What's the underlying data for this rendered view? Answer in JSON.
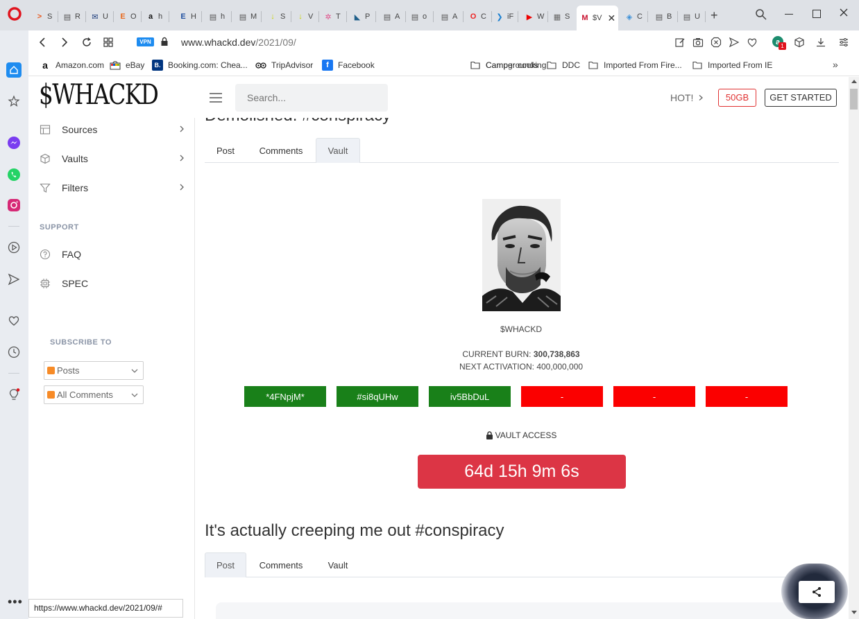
{
  "browser": {
    "tabs": [
      {
        "letter": ">",
        "label": "S",
        "color": "#e8591f"
      },
      {
        "letter": "▤",
        "label": "R",
        "color": "#555"
      },
      {
        "letter": "✉",
        "label": "U",
        "color": "#1a3a7a"
      },
      {
        "letter": "E",
        "label": "O",
        "color": "#e86a1f"
      },
      {
        "letter": "a",
        "label": "h",
        "color": "#111"
      },
      {
        "letter": "E",
        "label": "H",
        "color": "#1f4fa0"
      },
      {
        "letter": "▤",
        "label": "h",
        "color": "#555"
      },
      {
        "letter": "▤",
        "label": "M",
        "color": "#555"
      },
      {
        "letter": "↓",
        "label": "S",
        "color": "#c9d400"
      },
      {
        "letter": "↓",
        "label": "V",
        "color": "#c9d400"
      },
      {
        "letter": "✲",
        "label": "T",
        "color": "#e0508a"
      },
      {
        "letter": "◣",
        "label": "P",
        "color": "#1f5f8a"
      },
      {
        "letter": "▤",
        "label": "A",
        "color": "#555"
      },
      {
        "letter": "▤",
        "label": "o",
        "color": "#555"
      },
      {
        "letter": "▤",
        "label": "A",
        "color": "#555"
      },
      {
        "letter": "O",
        "label": "C",
        "color": "#e22"
      },
      {
        "letter": "❯",
        "label": "iF",
        "color": "#1a7fd0"
      },
      {
        "letter": "▶",
        "label": "W",
        "color": "#e00"
      },
      {
        "letter": "▦",
        "label": "S",
        "color": "#666"
      },
      {
        "letter": "M",
        "label": "$V",
        "color": "#c8102e"
      },
      {
        "letter": "◈",
        "label": "C",
        "color": "#3a8fd8"
      },
      {
        "letter": "▤",
        "label": "B",
        "color": "#555"
      },
      {
        "letter": "▤",
        "label": "U",
        "color": "#555"
      }
    ],
    "url_host": "www.whackd.dev",
    "url_path": "/2021/09/",
    "vpn_label": "VPN",
    "bookmarks": [
      {
        "icon": "a",
        "label": "Amazon.com"
      },
      {
        "icon": "ebay",
        "label": "eBay"
      },
      {
        "icon": "B.",
        "label": "Booking.com: Chea..."
      },
      {
        "icon": "owl",
        "label": "TripAdvisor"
      },
      {
        "icon": "f",
        "label": "Facebook"
      },
      {
        "icon": "folder",
        "label": "Camper cooking"
      },
      {
        "icon": "folder",
        "label": "Campgrounds"
      },
      {
        "icon": "folder",
        "label": "DDC"
      },
      {
        "icon": "folder",
        "label": "Imported From Fire..."
      },
      {
        "icon": "folder",
        "label": "Imported From IE"
      }
    ],
    "status_url": "https://www.whackd.dev/2021/09/#",
    "badge_count": "1"
  },
  "site": {
    "logo": "$WHACKD",
    "search_placeholder": "Search...",
    "hot_label": "HOT!",
    "storage_label": "50GB",
    "get_started_label": "GET STARTED",
    "sidebar": {
      "items": [
        {
          "label": "Sources"
        },
        {
          "label": "Vaults"
        },
        {
          "label": "Filters"
        }
      ],
      "support_heading": "SUPPORT",
      "support_items": [
        {
          "label": "FAQ"
        },
        {
          "label": "SPEC"
        }
      ],
      "subscribe_heading": "SUBSCRIBE TO",
      "subscribe_options": [
        {
          "label": "Posts"
        },
        {
          "label": "All Comments"
        }
      ]
    },
    "post1": {
      "title": "Demolished. #conspiracy",
      "tabs": [
        "Post",
        "Comments",
        "Vault"
      ],
      "vault_name": "$WHACKD",
      "burn_label": "CURRENT BURN:",
      "burn_value": "300,738,863",
      "activation_label": "NEXT ACTIVATION:",
      "activation_value": "400,000,000",
      "keys": [
        {
          "label": "*4FNpjM*",
          "state": "green"
        },
        {
          "label": "#si8qUHw",
          "state": "green"
        },
        {
          "label": "iv5BbDuL",
          "state": "green"
        },
        {
          "label": "-",
          "state": "red"
        },
        {
          "label": "-",
          "state": "red"
        },
        {
          "label": "-",
          "state": "red"
        }
      ],
      "vault_access_label": "VAULT ACCESS",
      "countdown": "64d 15h 9m 6s"
    },
    "post2": {
      "title": "It's actually creeping me out #conspiracy",
      "tabs": [
        "Post",
        "Comments",
        "Vault"
      ]
    }
  },
  "colors": {
    "accent_red": "#dc3545",
    "key_green": "#198019",
    "key_red": "#fb0000",
    "storage_red": "#e03131"
  }
}
